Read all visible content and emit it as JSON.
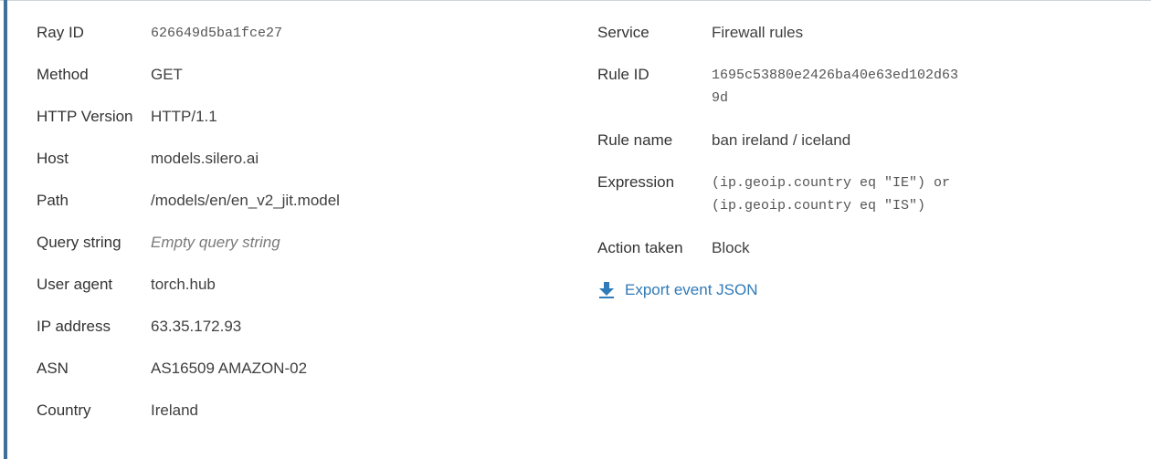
{
  "left": [
    {
      "label": "Ray ID",
      "value": "626649d5ba1fce27"
    },
    {
      "label": "Method",
      "value": "GET"
    },
    {
      "label": "HTTP Version",
      "value": "HTTP/1.1"
    },
    {
      "label": "Host",
      "value": "models.silero.ai"
    },
    {
      "label": "Path",
      "value": "/models/en/en_v2_jit.model"
    },
    {
      "label": "Query string",
      "value": "Empty query string"
    },
    {
      "label": "User agent",
      "value": "torch.hub"
    },
    {
      "label": "IP address",
      "value": "63.35.172.93"
    },
    {
      "label": "ASN",
      "value": "AS16509 AMAZON-02"
    },
    {
      "label": "Country",
      "value": "Ireland"
    }
  ],
  "right": {
    "service": {
      "label": "Service",
      "value": "Firewall rules"
    },
    "rule_id": {
      "label": "Rule ID",
      "line1": "1695c53880e2426ba40e63ed102d63",
      "line2": "9d"
    },
    "rule_name": {
      "label": "Rule name",
      "value": "ban ireland / iceland"
    },
    "expression": {
      "label": "Expression",
      "line1": "(ip.geoip.country eq \"IE\") or",
      "line2": "(ip.geoip.country eq \"IS\")"
    },
    "action": {
      "label": "Action taken",
      "value": "Block"
    }
  },
  "export": {
    "label": "Export event JSON",
    "icon": "download-arrow-icon"
  },
  "colors": {
    "accent": "#3f6f9b",
    "link": "#2f7ab8"
  }
}
